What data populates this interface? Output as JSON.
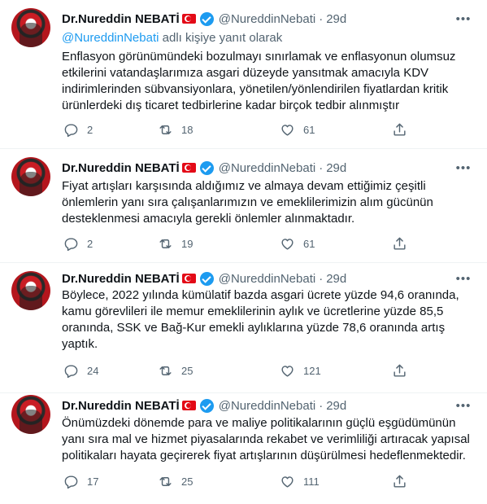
{
  "tweets": [
    {
      "name": "Dr.Nureddin NEBATİ",
      "handle": "@NureddinNebati",
      "separator": "·",
      "time": "29d",
      "reply_to_handle": "@NureddinNebati",
      "reply_to_suffix": " adlı kişiye yanıt olarak",
      "text": "Enflasyon görünümündeki bozulmayı sınırlamak ve enflasyonun olumsuz etkilerini vatandaşlarımıza asgari düzeyde yansıtmak amacıyla KDV indirimlerinden sübvansiyonlara, yönetilen/yönlendirilen fiyatlardan kritik ürünlerdeki dış ticaret tedbirlerine kadar birçok tedbir alınmıştır",
      "replies": "2",
      "retweets": "18",
      "likes": "61"
    },
    {
      "name": "Dr.Nureddin NEBATİ",
      "handle": "@NureddinNebati",
      "separator": "·",
      "time": "29d",
      "text": "Fiyat artışları karşısında aldığımız ve almaya devam ettiğimiz çeşitli önlemlerin yanı sıra çalışanlarımızın ve emeklilerimizin alım gücünün desteklenmesi amacıyla gerekli önlemler alınmaktadır.",
      "replies": "2",
      "retweets": "19",
      "likes": "61"
    },
    {
      "name": "Dr.Nureddin NEBATİ",
      "handle": "@NureddinNebati",
      "separator": "·",
      "time": "29d",
      "text": "Böylece, 2022 yılında kümülatif bazda asgari ücrete yüzde 94,6 oranında, kamu görevlileri ile memur emeklilerinin aylık ve ücretlerine yüzde 85,5 oranında, SSK ve Bağ-Kur emekli aylıklarına yüzde 78,6 oranında artış yaptık.",
      "replies": "24",
      "retweets": "25",
      "likes": "121"
    },
    {
      "name": "Dr.Nureddin NEBATİ",
      "handle": "@NureddinNebati",
      "separator": "·",
      "time": "29d",
      "text": "Önümüzdeki dönemde para ve maliye politikalarının güçlü eşgüdümünün yanı sıra mal ve hizmet piyasalarında rekabet ve verimliliği artıracak yapısal politikaları hayata geçirerek fiyat artışlarının düşürülmesi hedeflenmektedir.",
      "replies": "17",
      "retweets": "25",
      "likes": "111"
    }
  ],
  "icons": {
    "flag": "turkey-flag-icon",
    "verified": "verified-badge-icon",
    "more": "more-options-icon",
    "reply": "reply-icon",
    "retweet": "retweet-icon",
    "like": "like-icon",
    "share": "share-icon"
  },
  "colors": {
    "accent": "#1d9bf0",
    "secondary_text": "#536471",
    "primary_text": "#0f1419",
    "divider": "#eff3f4"
  }
}
